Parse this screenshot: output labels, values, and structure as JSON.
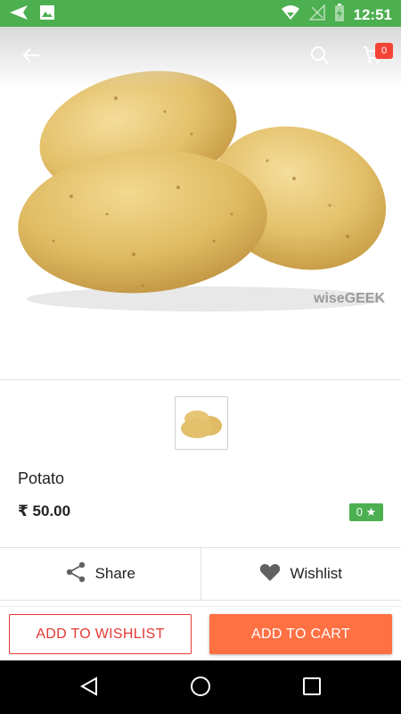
{
  "status_bar": {
    "time": "12:51"
  },
  "toolbar": {
    "cart_count": "0"
  },
  "product": {
    "watermark": "wiseGEEK",
    "name": "Potato",
    "price": "₹ 50.00",
    "rating": "0 ★"
  },
  "actions": {
    "share_label": "Share",
    "wishlist_label": "Wishlist"
  },
  "buttons": {
    "add_to_wishlist": "ADD TO WISHLIST",
    "add_to_cart": "ADD TO CART"
  },
  "colors": {
    "status_bar": "#4CAF50",
    "primary_button": "#FF7043",
    "outline_button": "#E53935",
    "badge": "#F44336"
  },
  "icons": [
    "send-icon",
    "image-icon",
    "wifi-icon",
    "signal-icon",
    "battery-icon",
    "back-arrow-icon",
    "search-icon",
    "cart-icon",
    "share-icon",
    "heart-icon",
    "nav-back-icon",
    "nav-home-icon",
    "nav-recents-icon"
  ]
}
